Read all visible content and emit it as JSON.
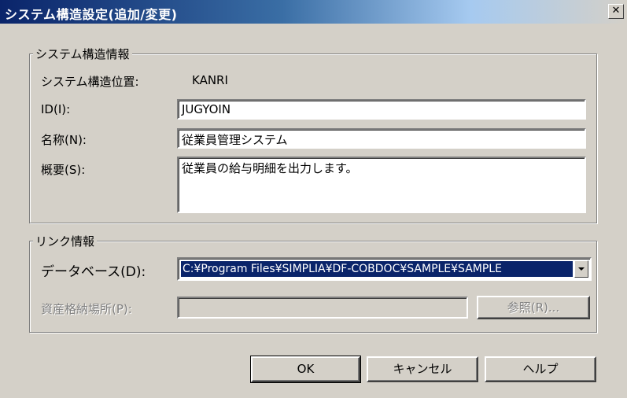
{
  "window": {
    "title": "システム構造設定(追加/変更)",
    "close_glyph": "✕"
  },
  "system_info": {
    "group_title": "システム構造情報",
    "position_label": "システム構造位置:",
    "position_value": "KANRI",
    "id_label": "ID(I):",
    "id_value": "JUGYOIN",
    "name_label": "名称(N):",
    "name_value": "従業員管理システム",
    "summary_label": "概要(S):",
    "summary_value": "従業員の給与明細を出力します。"
  },
  "link_info": {
    "group_title": "リンク情報",
    "database_label": "データベース(D):",
    "database_value": "C:¥Program Files¥SIMPLIA¥DF-COBDOC¥SAMPLE¥SAMPLE",
    "asset_location_label": "資産格納場所(P):",
    "asset_location_value": "",
    "browse_label": "参照(R)..."
  },
  "buttons": {
    "ok": "OK",
    "cancel": "キャンセル",
    "help": "ヘルプ"
  }
}
